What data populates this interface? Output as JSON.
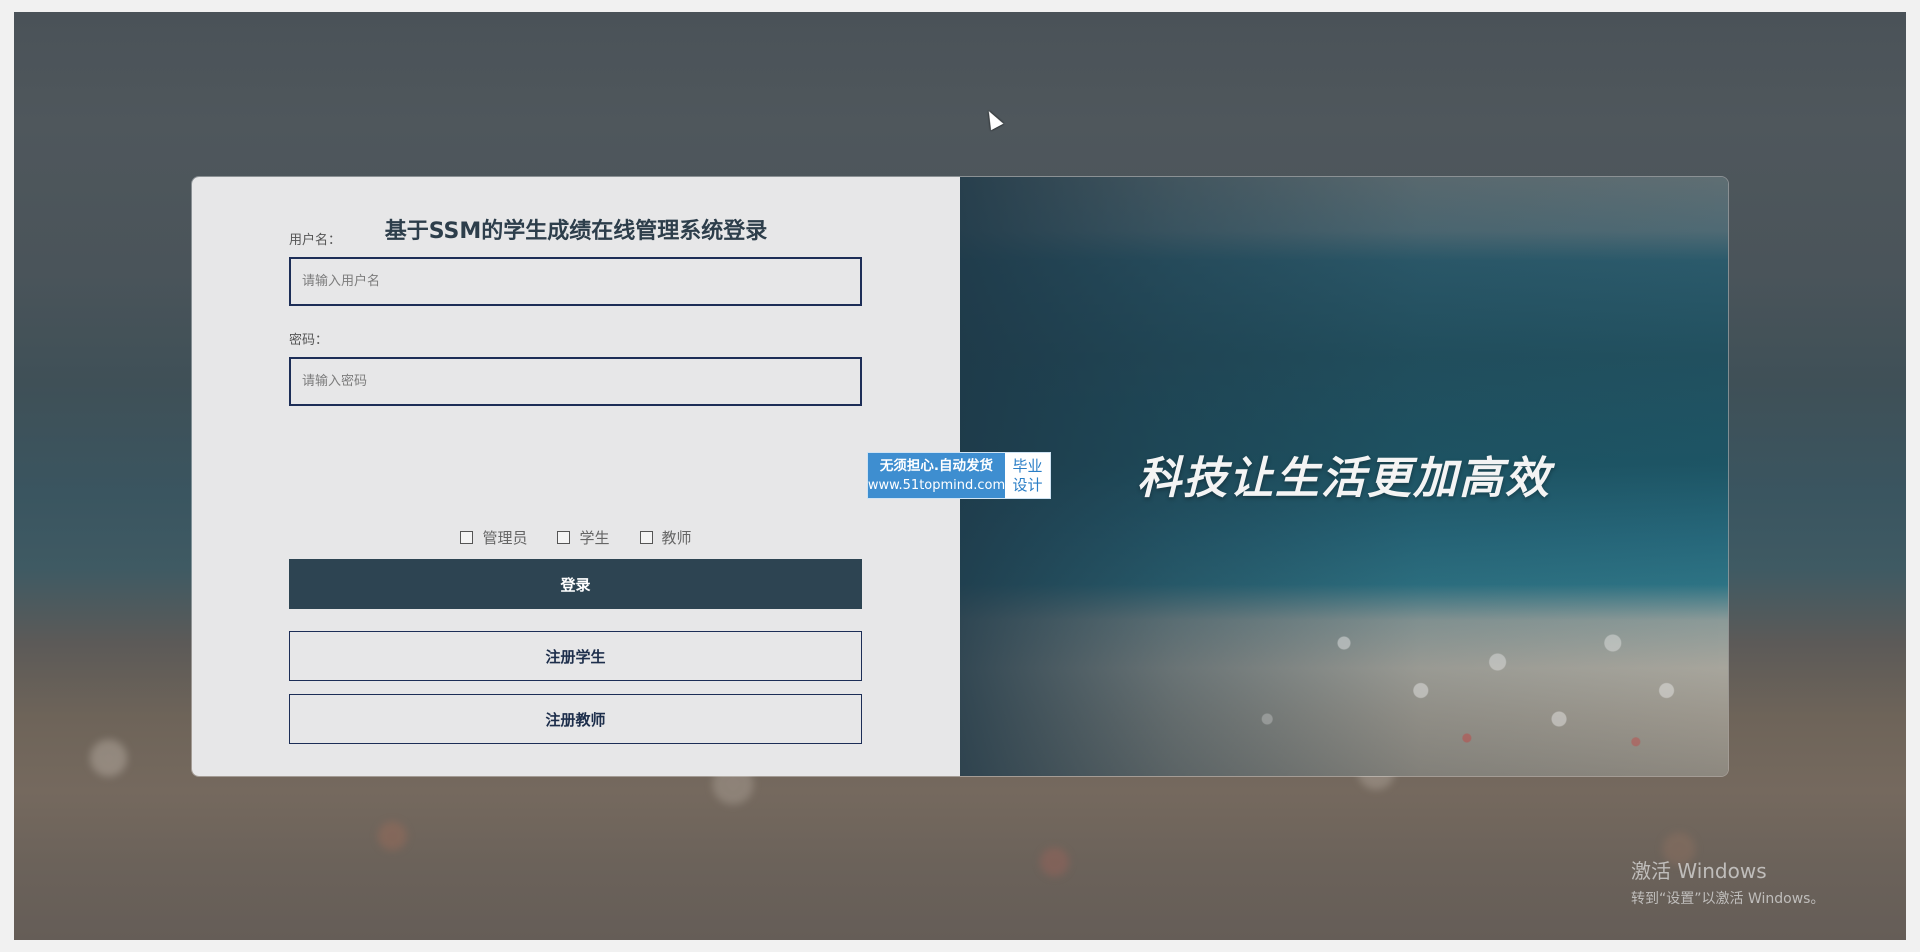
{
  "login": {
    "title": "基于SSM的学生成绩在线管理系统登录",
    "username_label": "用户名：",
    "username_placeholder": "请输入用户名",
    "password_label": "密码：",
    "password_placeholder": "请输入密码",
    "roles": [
      "管理员",
      "学生",
      "教师"
    ],
    "login_button": "登录",
    "register_student_button": "注册学生",
    "register_teacher_button": "注册教师"
  },
  "hero": {
    "slogan": "科技让生活更加高效"
  },
  "ad": {
    "line1": "无须担心.自动发货",
    "line2": "www.51topmind.com",
    "right1": "毕业",
    "right2": "设计"
  },
  "watermark": {
    "line1": "激活 Windows",
    "line2": "转到“设置”以激活 Windows。"
  },
  "colors": {
    "primary_button": "#2d4452",
    "input_border": "#1d2e57",
    "title": "#2d3e4b"
  }
}
